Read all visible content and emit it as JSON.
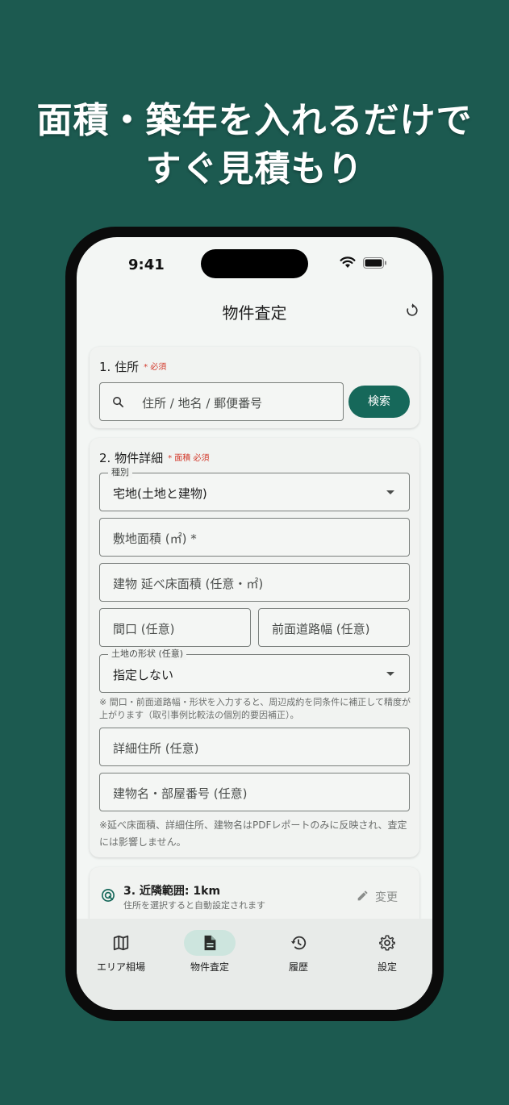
{
  "headline": {
    "line1": "面積・築年を入れるだけで",
    "line2": "すぐ見積もり"
  },
  "status_bar": {
    "time": "9:41"
  },
  "app_bar": {
    "title": "物件査定",
    "refresh_icon": "refresh-icon"
  },
  "section1": {
    "title": "1. 住所",
    "required": "* 必須",
    "search_placeholder": "住所 / 地名 / 郵便番号",
    "search_button": "検索"
  },
  "section2": {
    "title": "2. 物件詳細",
    "required": "* 面積 必須",
    "type_label": "種別",
    "type_value": "宅地(土地と建物)",
    "land_area": "敷地面積 (㎡) *",
    "floor_area": "建物 延べ床面積 (任意・㎡)",
    "frontage": "間口 (任意)",
    "road_width": "前面道路幅 (任意)",
    "shape_label": "土地の形状 (任意)",
    "shape_value": "指定しない",
    "note1": "※ 間口・前面道路幅・形状を入力すると、周辺成約を同条件に補正して精度が上がります（取引事例比較法の個別的要因補正）。",
    "detail_address": "詳細住所 (任意)",
    "building_name": "建物名・部屋番号 (任意)",
    "note2": "※延べ床面積、詳細住所、建物名はPDFレポートのみに反映され、査定には影響しません。"
  },
  "section3": {
    "title": "3. 近隣範囲: 1km",
    "subtitle": "住所を選択すると自動設定されます",
    "change_label": "変更"
  },
  "bottom_nav": {
    "items": [
      {
        "label": "エリア相場",
        "icon": "map-icon"
      },
      {
        "label": "物件査定",
        "icon": "document-icon"
      },
      {
        "label": "履歴",
        "icon": "history-icon"
      },
      {
        "label": "設定",
        "icon": "gear-icon"
      }
    ],
    "active_index": 1
  },
  "colors": {
    "background": "#1c5a50",
    "accent": "#16685a",
    "required": "#d33a2c",
    "active_pill": "#cde5de"
  }
}
